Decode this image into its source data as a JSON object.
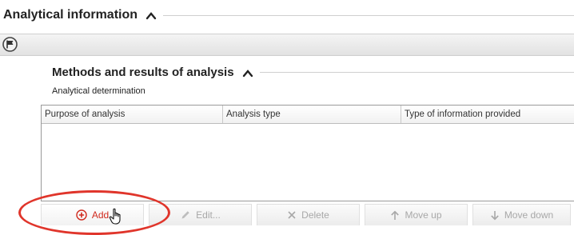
{
  "section": {
    "title": "Analytical information"
  },
  "subsection": {
    "title": "Methods and results of analysis"
  },
  "field": {
    "label": "Analytical determination"
  },
  "table": {
    "columns": [
      "Purpose of analysis",
      "Analysis type",
      "Type of information provided"
    ],
    "rows": []
  },
  "toolbar": {
    "add_label": "Add",
    "edit_label": "Edit...",
    "delete_label": "Delete",
    "move_up_label": "Move up",
    "move_down_label": "Move down"
  },
  "colors": {
    "accent_red": "#e0352b",
    "add_text": "#d02a1e",
    "disabled_text": "#a8a8a8"
  },
  "icons": [
    "chevron-up-icon",
    "flag-icon",
    "add-circle-icon",
    "pencil-icon",
    "x-icon",
    "arrow-up-icon",
    "arrow-down-icon",
    "hand-cursor-icon"
  ]
}
